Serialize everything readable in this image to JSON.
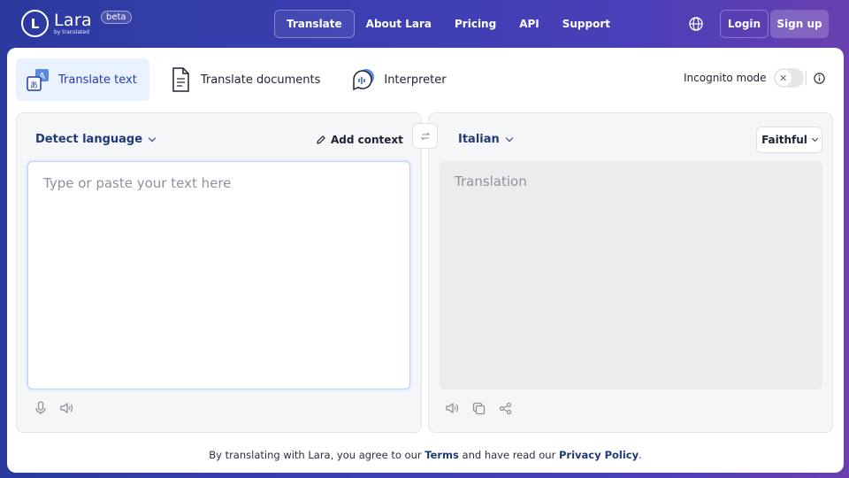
{
  "brand": {
    "logo_letter": "L",
    "name": "Lara",
    "subtitle": "by translated",
    "badge": "beta"
  },
  "nav": {
    "links": [
      "Translate",
      "About Lara",
      "Pricing",
      "API",
      "Support"
    ],
    "active": "Translate",
    "language_icon": "globe-icon",
    "login": "Login",
    "signup": "Sign up"
  },
  "modes": [
    {
      "label": "Translate text",
      "icon": "translate-text-icon",
      "active": true
    },
    {
      "label": "Translate documents",
      "icon": "document-icon",
      "active": false
    },
    {
      "label": "Interpreter",
      "icon": "chat-audio-icon",
      "active": false
    }
  ],
  "incognito": {
    "label": "Incognito mode",
    "enabled": false,
    "toggle_icon": "✕",
    "info_icon": "info-icon"
  },
  "source": {
    "language": "Detect language",
    "add_context": "Add context",
    "placeholder": "Type or paste your text here",
    "tools": [
      "microphone-icon",
      "speaker-icon"
    ]
  },
  "swap_icon": "swap-icon",
  "target": {
    "language": "Italian",
    "style": "Faithful",
    "placeholder": "Translation",
    "tools": [
      "speaker-icon",
      "copy-icon",
      "share-icon"
    ]
  },
  "footer": {
    "prefix": "By translating with Lara, you agree to our ",
    "terms": "Terms",
    "middle": " and have read our ",
    "privacy": "Privacy Policy",
    "suffix": "."
  },
  "colors": {
    "accent": "#1f3a7a",
    "active_tab_bg": "#e8f1fd",
    "header_gradient_start": "#2b3a9e",
    "header_gradient_end": "#6a3fb0"
  }
}
